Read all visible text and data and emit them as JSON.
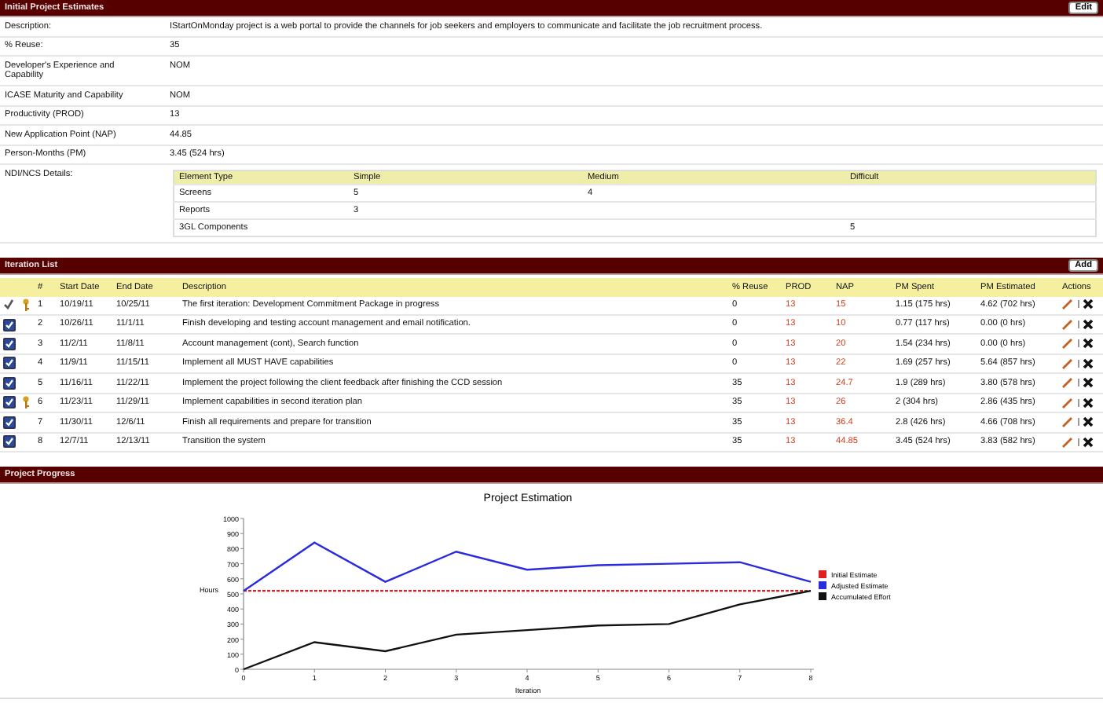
{
  "estimates": {
    "title": "Initial Project Estimates",
    "edit_button": "Edit",
    "fields": [
      {
        "label": "Description:",
        "value": "IStartOnMonday project is a web portal to provide the channels for job seekers and employers to communicate and facilitate the job recruitment process."
      },
      {
        "label": "% Reuse:",
        "value": "35"
      },
      {
        "label": "Developer's Experience and Capability",
        "value": "NOM"
      },
      {
        "label": "ICASE Maturity and Capability",
        "value": "NOM"
      },
      {
        "label": "Productivity (PROD)",
        "value": "13"
      },
      {
        "label": "New Application Point (NAP)",
        "value": "44.85"
      },
      {
        "label": "Person-Months (PM)",
        "value": "3.45 (524 hrs)"
      }
    ],
    "ndi_label": "NDI/NCS Details:",
    "ndi_columns": [
      "Element Type",
      "Simple",
      "Medium",
      "Difficult"
    ],
    "ndi_rows": [
      [
        "Screens",
        "5",
        "4",
        ""
      ],
      [
        "Reports",
        "3",
        "",
        ""
      ],
      [
        "3GL Components",
        "",
        "",
        "5"
      ]
    ]
  },
  "iterations": {
    "title": "Iteration List",
    "add_button": "Add",
    "columns": [
      "#",
      "Start Date",
      "End Date",
      "Description",
      "% Reuse",
      "PROD",
      "NAP",
      "PM Spent",
      "PM Estimated",
      "Actions"
    ],
    "rows": [
      {
        "kind": "tick",
        "checked": true,
        "milestone": true,
        "cells": [
          "1",
          "10/19/11",
          "10/25/11",
          "The first iteration: Development Commitment Package in progress",
          "0",
          "13",
          "15",
          "1.15 (175 hrs)",
          "4.62 (702 hrs)"
        ]
      },
      {
        "kind": "checkbox",
        "checked": true,
        "milestone": false,
        "cells": [
          "2",
          "10/26/11",
          "11/1/11",
          "Finish developing and testing account management and email notification.",
          "0",
          "13",
          "10",
          "0.77 (117 hrs)",
          "0.00 (0 hrs)"
        ]
      },
      {
        "kind": "checkbox",
        "checked": true,
        "milestone": false,
        "cells": [
          "3",
          "11/2/11",
          "11/8/11",
          "Account management (cont), Search function",
          "0",
          "13",
          "20",
          "1.54 (234 hrs)",
          "0.00 (0 hrs)"
        ]
      },
      {
        "kind": "checkbox",
        "checked": true,
        "milestone": false,
        "cells": [
          "4",
          "11/9/11",
          "11/15/11",
          "Implement all MUST HAVE capabilities",
          "0",
          "13",
          "22",
          "1.69 (257 hrs)",
          "5.64 (857 hrs)"
        ]
      },
      {
        "kind": "checkbox",
        "checked": true,
        "milestone": false,
        "cells": [
          "5",
          "11/16/11",
          "11/22/11",
          "Implement the project following the client feedback after finishing the CCD session",
          "35",
          "13",
          "24.7",
          "1.9 (289 hrs)",
          "3.80 (578 hrs)"
        ]
      },
      {
        "kind": "checkbox",
        "checked": true,
        "milestone": true,
        "cells": [
          "6",
          "11/23/11",
          "11/29/11",
          "Implement capabilities in second iteration plan",
          "35",
          "13",
          "26",
          "2 (304 hrs)",
          "2.86 (435 hrs)"
        ]
      },
      {
        "kind": "checkbox",
        "checked": true,
        "milestone": false,
        "cells": [
          "7",
          "11/30/11",
          "12/6/11",
          "Finish all requirements and prepare for transition",
          "35",
          "13",
          "36.4",
          "2.8 (426 hrs)",
          "4.66 (708 hrs)"
        ]
      },
      {
        "kind": "checkbox",
        "checked": true,
        "milestone": false,
        "cells": [
          "8",
          "12/7/11",
          "12/13/11",
          "Transition the system",
          "35",
          "13",
          "44.85",
          "3.45 (524 hrs)",
          "3.83 (582 hrs)"
        ]
      }
    ]
  },
  "progress": {
    "title": "Project Progress",
    "chart_data": {
      "type": "line",
      "title": "Project Estimation",
      "xlabel": "Iteration",
      "ylabel": "Hours",
      "x": [
        0,
        1,
        2,
        3,
        4,
        5,
        6,
        7,
        8
      ],
      "xlim": [
        0,
        8
      ],
      "ylim": [
        0,
        1000
      ],
      "xticks": [
        0,
        1,
        2,
        3,
        4,
        5,
        6,
        7,
        8
      ],
      "yticks": [
        0,
        100,
        200,
        300,
        400,
        500,
        600,
        700,
        800,
        900,
        1000
      ],
      "legend": true,
      "series": [
        {
          "name": "Initial Estimate",
          "color": "#e02020",
          "line_style": "dashed",
          "values": [
            520,
            520,
            520,
            520,
            520,
            520,
            520,
            520,
            520
          ]
        },
        {
          "name": "Adjusted Estimate",
          "color": "#2a2adf",
          "line_style": "solid",
          "values": [
            520,
            840,
            580,
            780,
            660,
            690,
            700,
            710,
            580
          ]
        },
        {
          "name": "Accumulated Effort",
          "color": "#111111",
          "line_style": "solid",
          "values": [
            0,
            180,
            120,
            230,
            260,
            290,
            300,
            430,
            520
          ]
        }
      ]
    }
  }
}
